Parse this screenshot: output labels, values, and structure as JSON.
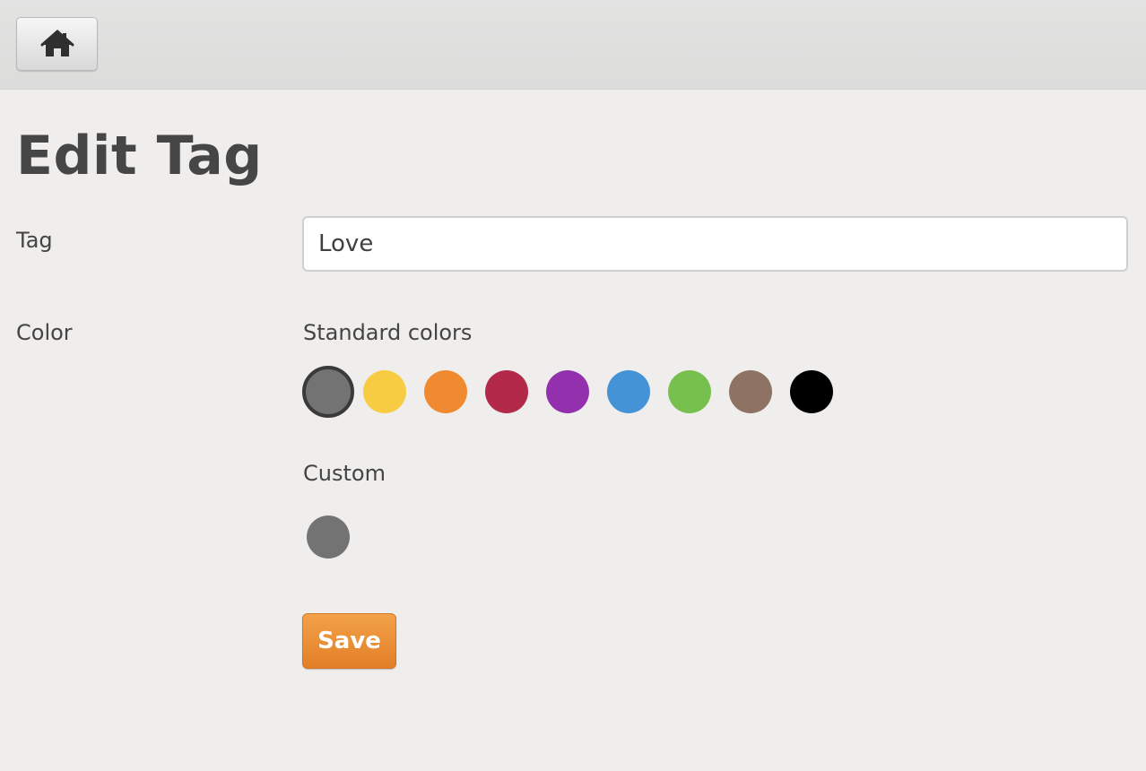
{
  "header": {
    "home_icon": "home-icon"
  },
  "page": {
    "title": "Edit Tag"
  },
  "form": {
    "tag_label": "Tag",
    "tag_value": "Love",
    "color_label": "Color",
    "standard_heading": "Standard colors",
    "standard_colors": [
      {
        "name": "gray",
        "hex": "#737373",
        "selected": true
      },
      {
        "name": "yellow",
        "hex": "#f7cc43"
      },
      {
        "name": "orange",
        "hex": "#f08a31"
      },
      {
        "name": "crimson",
        "hex": "#b2294a"
      },
      {
        "name": "purple",
        "hex": "#9330ad"
      },
      {
        "name": "blue",
        "hex": "#4393d6"
      },
      {
        "name": "green",
        "hex": "#78c04d"
      },
      {
        "name": "brown",
        "hex": "#8e7263"
      },
      {
        "name": "black",
        "hex": "#000000"
      }
    ],
    "custom_heading": "Custom",
    "custom_color": "#737373",
    "save_label": "Save"
  },
  "colors": {
    "accent": "#e9872e"
  }
}
